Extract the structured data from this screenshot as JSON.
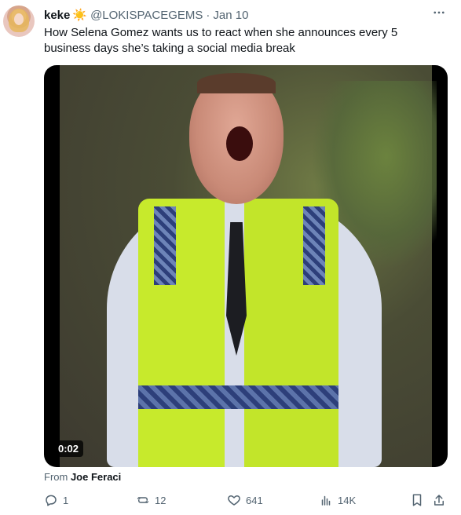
{
  "tweet": {
    "author_name": "keke",
    "author_emoji": "☀️",
    "handle": "@LOKISPACEGEMS",
    "separator": "·",
    "date": "Jan 10",
    "text": "How Selena Gomez wants us to react when she announces every 5 business days she’s taking a social media break",
    "more_icon": "more-icon"
  },
  "media": {
    "duration": "0:02"
  },
  "attribution": {
    "prefix": "From ",
    "source": "Joe Feraci"
  },
  "actions": {
    "replies": "1",
    "reposts": "12",
    "likes": "641",
    "views": "14K"
  },
  "colors": {
    "text": "#0f1419",
    "muted": "#536471"
  }
}
